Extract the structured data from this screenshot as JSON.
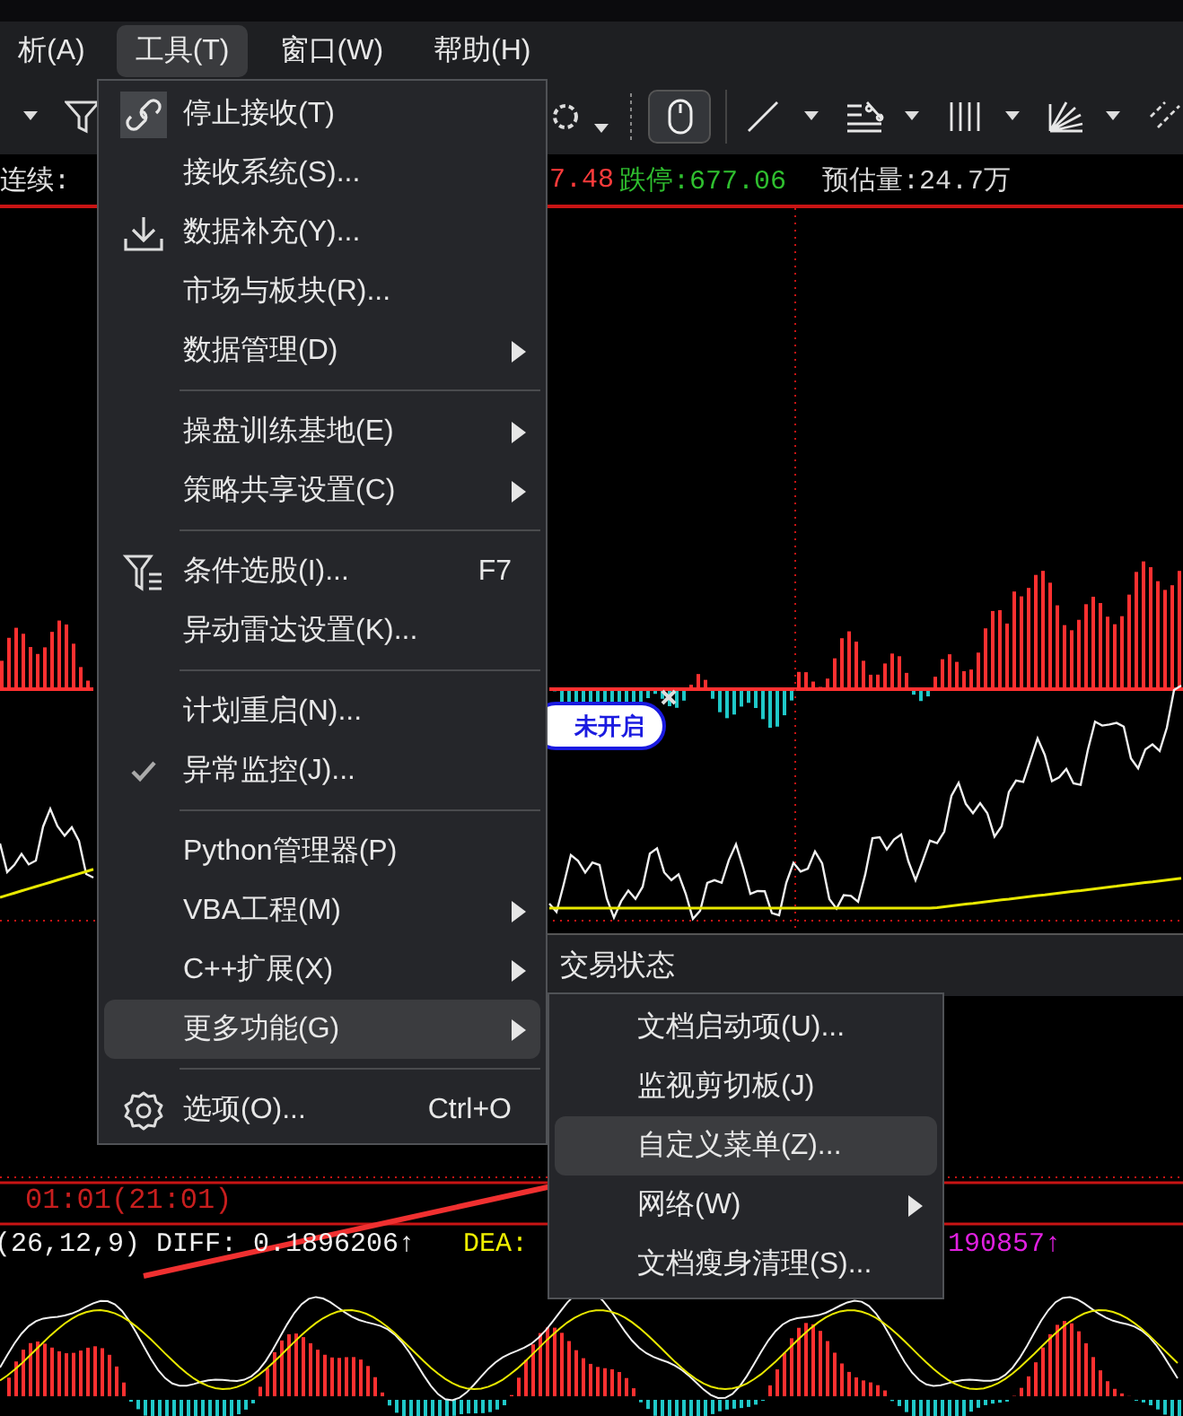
{
  "menubar": [
    {
      "label": "析(A)",
      "selected": false
    },
    {
      "label": "工具(T)",
      "selected": true
    },
    {
      "label": "窗口(W)",
      "selected": false
    },
    {
      "label": "帮助(H)",
      "selected": false
    }
  ],
  "info_line": [
    {
      "text": "连续: ",
      "color": "#e0e0e0"
    },
    {
      "text": "7.48",
      "color": "#ff3b3b"
    },
    {
      "text": "跌停:677.06",
      "color": "#2fbf2f"
    },
    {
      "text": "预估量:24.7万",
      "color": "#d8d8d8"
    }
  ],
  "badge": "未开启",
  "trade_panel": {
    "title": "交易状态"
  },
  "bottom_lines": [
    {
      "text": "01:01(21:01)",
      "color": "#c81e1e"
    }
  ],
  "indicator_line": [
    {
      "text": "(26,12,9) DIFF: 0.1896206↑",
      "color": "#f0f0f0"
    },
    {
      "text": "DEA:",
      "color": "#f0f000"
    },
    {
      "text": "190857↑",
      "color": "#e020e0"
    }
  ],
  "tools_menu": [
    {
      "kind": "item",
      "label": "停止接收(T)",
      "selected": false,
      "checked": false,
      "submenu": false
    },
    {
      "kind": "item",
      "label": "接收系统(S)...",
      "selected": false,
      "checked": false,
      "submenu": false
    },
    {
      "kind": "item",
      "label": "数据补充(Y)...",
      "selected": false,
      "checked": false,
      "submenu": false
    },
    {
      "kind": "item",
      "label": "市场与板块(R)...",
      "selected": false,
      "checked": false,
      "submenu": false
    },
    {
      "kind": "item",
      "label": "数据管理(D)",
      "selected": false,
      "checked": false,
      "submenu": true
    },
    {
      "kind": "separator"
    },
    {
      "kind": "item",
      "label": "操盘训练基地(E)",
      "selected": false,
      "checked": false,
      "submenu": true
    },
    {
      "kind": "item",
      "label": "策略共享设置(C)",
      "selected": false,
      "checked": false,
      "submenu": true
    },
    {
      "kind": "separator"
    },
    {
      "kind": "item",
      "label": "条件选股(I)...",
      "shortcut": "F7",
      "selected": false,
      "checked": false,
      "submenu": false
    },
    {
      "kind": "item",
      "label": "异动雷达设置(K)...",
      "selected": false,
      "checked": false,
      "submenu": false
    },
    {
      "kind": "separator"
    },
    {
      "kind": "item",
      "label": "计划重启(N)...",
      "selected": false,
      "checked": false,
      "submenu": false
    },
    {
      "kind": "item",
      "label": "异常监控(J)...",
      "selected": false,
      "checked": true,
      "submenu": false
    },
    {
      "kind": "separator"
    },
    {
      "kind": "item",
      "label": "Python管理器(P)",
      "selected": false,
      "checked": false,
      "submenu": false
    },
    {
      "kind": "item",
      "label": "VBA工程(M)",
      "selected": false,
      "checked": false,
      "submenu": true
    },
    {
      "kind": "item",
      "label": "C++扩展(X)",
      "selected": false,
      "checked": false,
      "submenu": true
    },
    {
      "kind": "item",
      "label": "更多功能(G)",
      "selected": true,
      "checked": false,
      "submenu": true
    },
    {
      "kind": "separator"
    },
    {
      "kind": "item",
      "label": "选项(O)...",
      "shortcut": "Ctrl+O",
      "selected": false,
      "checked": false,
      "submenu": false
    }
  ],
  "more_menu": [
    {
      "kind": "item",
      "label": "文档启动项(U)...",
      "selected": false,
      "submenu": false
    },
    {
      "kind": "item",
      "label": "监视剪切板(J)",
      "selected": false,
      "submenu": false
    },
    {
      "kind": "item",
      "label": "自定义菜单(Z)...",
      "selected": true,
      "submenu": false
    },
    {
      "kind": "item",
      "label": "网络(W)",
      "selected": false,
      "submenu": true
    },
    {
      "kind": "item",
      "label": "文档瘦身清理(S)...",
      "selected": false,
      "submenu": false
    }
  ]
}
